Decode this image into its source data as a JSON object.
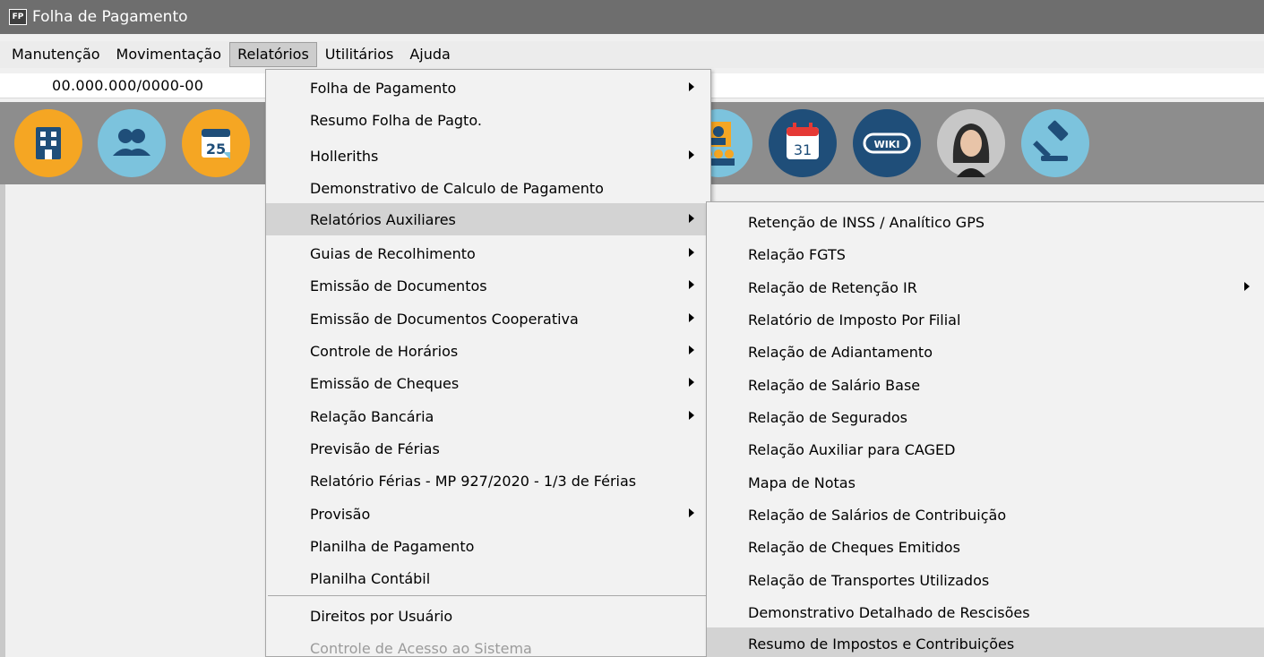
{
  "window": {
    "app_icon_text": "FP",
    "title": "Folha de Pagamento"
  },
  "menubar": {
    "items": [
      "Manutenção",
      "Movimentação",
      "Relatórios",
      "Utilitários",
      "Ajuda"
    ],
    "active_index": 2
  },
  "company": {
    "cnpj": "00.000.000/0000-00"
  },
  "toolbar": {
    "buttons": [
      {
        "icon": "building-icon",
        "color": "#f5a623"
      },
      {
        "icon": "users-icon",
        "color": "#7cc3dd"
      },
      {
        "icon": "calendar-25-icon",
        "color": "#f5a623",
        "text": "25"
      },
      {
        "icon": "employees-icon",
        "color": "#7cc3dd"
      },
      {
        "icon": "calendar-31-icon",
        "color": "#1f4e79",
        "text": "31"
      },
      {
        "icon": "wiki-icon",
        "color": "#1f4e79",
        "text": "WIKI"
      },
      {
        "icon": "avatar-icon",
        "color": "#c7c7c7"
      },
      {
        "icon": "gavel-icon",
        "color": "#7cc3dd"
      }
    ]
  },
  "relatorios_menu": {
    "items": [
      {
        "label": "Folha de Pagamento",
        "submenu": true
      },
      {
        "label": "Resumo Folha de Pagto.",
        "submenu": false
      },
      {
        "label": "Holleriths",
        "submenu": true
      },
      {
        "label": "Demonstrativo de Calculo de Pagamento",
        "submenu": false
      },
      {
        "label": "Relatórios Auxiliares",
        "submenu": true,
        "highlighted": true
      },
      {
        "label": "Guias de Recolhimento",
        "submenu": true
      },
      {
        "label": "Emissão de Documentos",
        "submenu": true
      },
      {
        "label": "Emissão de Documentos Cooperativa",
        "submenu": true
      },
      {
        "label": "Controle de Horários",
        "submenu": true
      },
      {
        "label": "Emissão de Cheques",
        "submenu": true
      },
      {
        "label": "Relação Bancária",
        "submenu": true
      },
      {
        "label": "Previsão de Férias",
        "submenu": false
      },
      {
        "label": "Relatório Férias - MP 927/2020 - 1/3 de Férias",
        "submenu": false
      },
      {
        "label": "Provisão",
        "submenu": true
      },
      {
        "label": "Planilha de Pagamento",
        "submenu": false
      },
      {
        "label": "Planilha Contábil",
        "submenu": false
      },
      {
        "label": "Direitos por Usuário",
        "submenu": false
      },
      {
        "label": "Controle de Acesso ao Sistema",
        "submenu": false,
        "disabled": true
      }
    ]
  },
  "relatorios_auxiliares_menu": {
    "items": [
      {
        "label": "Retenção de INSS / Analítico GPS",
        "submenu": false
      },
      {
        "label": "Relação FGTS",
        "submenu": false
      },
      {
        "label": "Relação de Retenção IR",
        "submenu": true
      },
      {
        "label": "Relatório de Imposto Por Filial",
        "submenu": false
      },
      {
        "label": "Relação de Adiantamento",
        "submenu": false
      },
      {
        "label": "Relação de Salário Base",
        "submenu": false
      },
      {
        "label": "Relação de Segurados",
        "submenu": false
      },
      {
        "label": "Relação Auxiliar para CAGED",
        "submenu": false
      },
      {
        "label": "Mapa de Notas",
        "submenu": false
      },
      {
        "label": "Relação de Salários de Contribuição",
        "submenu": false
      },
      {
        "label": "Relação de Cheques Emitidos",
        "submenu": false
      },
      {
        "label": "Relação de Transportes Utilizados",
        "submenu": false
      },
      {
        "label": "Demonstrativo Detalhado de Rescisões",
        "submenu": false
      },
      {
        "label": "Resumo de Impostos e Contribuições",
        "submenu": false,
        "highlighted": true
      }
    ]
  }
}
